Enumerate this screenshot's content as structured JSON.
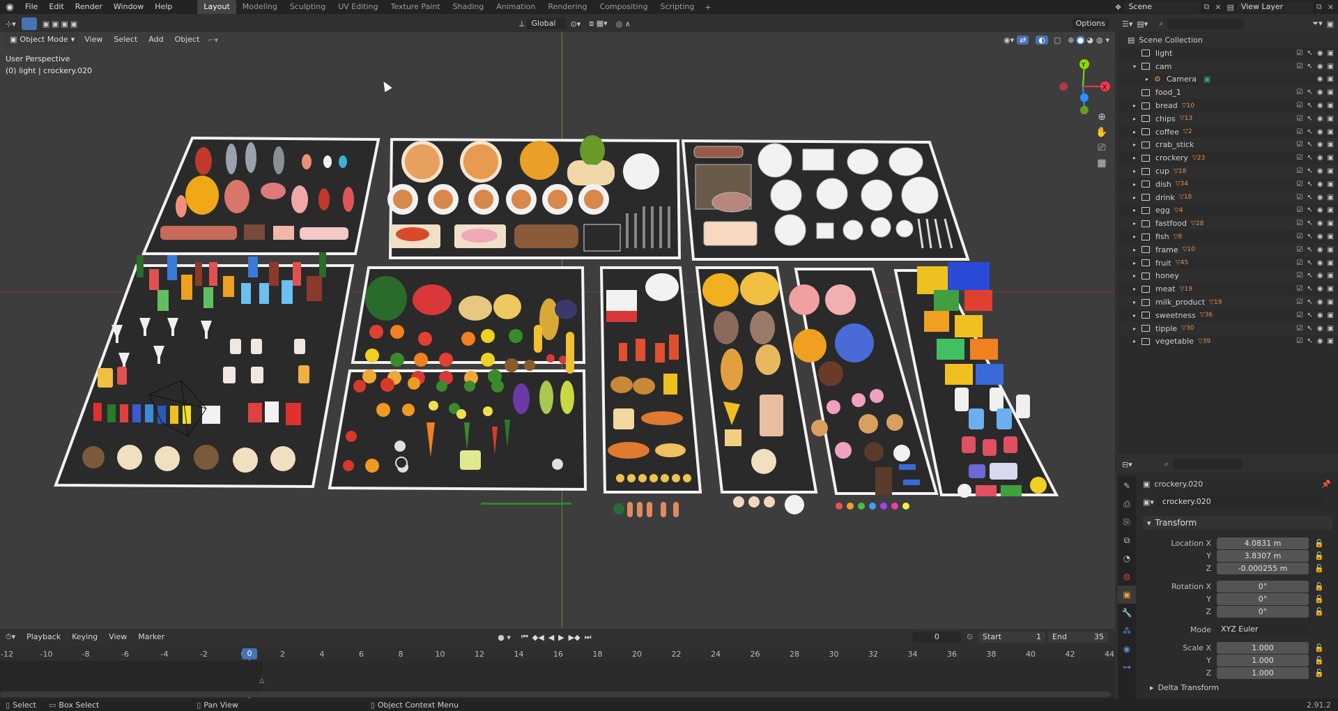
{
  "topbar": {
    "menus": [
      "File",
      "Edit",
      "Render",
      "Window",
      "Help"
    ],
    "workspaces": [
      "Layout",
      "Modeling",
      "Sculpting",
      "UV Editing",
      "Texture Paint",
      "Shading",
      "Animation",
      "Rendering",
      "Compositing",
      "Scripting"
    ],
    "active_workspace": "Layout",
    "scene_label": "Scene",
    "view_layer_label": "View Layer"
  },
  "viewport_header": {
    "transform_orientation": "Global",
    "options_label": "Options",
    "mode": "Object Mode",
    "menus": [
      "View",
      "Select",
      "Add",
      "Object"
    ]
  },
  "viewport": {
    "perspective_label": "User Perspective",
    "object_info": "(0) light | crockery.020",
    "gizmo_axes": [
      "X",
      "Y",
      "Z"
    ]
  },
  "outliner": {
    "root": "Scene Collection",
    "items": [
      {
        "label": "light",
        "level": 1,
        "expand": false,
        "badge": ""
      },
      {
        "label": "cam",
        "level": 1,
        "expand": true,
        "badge": ""
      },
      {
        "label": "Camera",
        "level": 2,
        "expand": false,
        "badge": "",
        "is_object": true
      },
      {
        "label": "food_1",
        "level": 1,
        "expand": false,
        "badge": ""
      },
      {
        "label": "bread",
        "level": 1,
        "expand": false,
        "badge": "10"
      },
      {
        "label": "chips",
        "level": 1,
        "expand": false,
        "badge": "13"
      },
      {
        "label": "coffee",
        "level": 1,
        "expand": false,
        "badge": "2"
      },
      {
        "label": "crab_stick",
        "level": 1,
        "expand": false,
        "badge": ""
      },
      {
        "label": "crockery",
        "level": 1,
        "expand": false,
        "badge": "23"
      },
      {
        "label": "cup",
        "level": 1,
        "expand": false,
        "badge": "18"
      },
      {
        "label": "dish",
        "level": 1,
        "expand": false,
        "badge": "34"
      },
      {
        "label": "drink",
        "level": 1,
        "expand": false,
        "badge": "18"
      },
      {
        "label": "egg",
        "level": 1,
        "expand": false,
        "badge": "4"
      },
      {
        "label": "fastfood",
        "level": 1,
        "expand": false,
        "badge": "28"
      },
      {
        "label": "fish",
        "level": 1,
        "expand": false,
        "badge": "8"
      },
      {
        "label": "frame",
        "level": 1,
        "expand": false,
        "badge": "10"
      },
      {
        "label": "fruit",
        "level": 1,
        "expand": false,
        "badge": "45"
      },
      {
        "label": "honey",
        "level": 1,
        "expand": false,
        "badge": ""
      },
      {
        "label": "meat",
        "level": 1,
        "expand": false,
        "badge": "19"
      },
      {
        "label": "milk_product",
        "level": 1,
        "expand": false,
        "badge": "19"
      },
      {
        "label": "sweetness",
        "level": 1,
        "expand": false,
        "badge": "36"
      },
      {
        "label": "tipple",
        "level": 1,
        "expand": false,
        "badge": "30"
      },
      {
        "label": "vegetable",
        "level": 1,
        "expand": false,
        "badge": "39"
      }
    ]
  },
  "properties": {
    "object_name": "crockery.020",
    "data_name": "crockery.020",
    "section": "Transform",
    "location": {
      "label": "Location X",
      "x": "4.0831 m",
      "y": "3.8307 m",
      "z": "-0.000255 m"
    },
    "rotation": {
      "label": "Rotation X",
      "x": "0°",
      "y": "0°",
      "z": "0°"
    },
    "mode_label": "Mode",
    "mode_value": "XYZ Euler",
    "scale": {
      "label": "Scale X",
      "x": "1.000",
      "y": "1.000",
      "z": "1.000"
    },
    "delta": "Delta Transform",
    "axis_y": "Y",
    "axis_z": "Z"
  },
  "timeline": {
    "menus": [
      "Playback",
      "Keying",
      "View",
      "Marker"
    ],
    "current_frame": "0",
    "start_label": "Start",
    "start": "1",
    "end_label": "End",
    "end": "35",
    "ticks": [
      "-12",
      "-10",
      "-8",
      "-6",
      "-4",
      "-2",
      "0",
      "2",
      "4",
      "6",
      "8",
      "10",
      "12",
      "14",
      "16",
      "18",
      "20",
      "22",
      "24",
      "26",
      "28",
      "30",
      "32",
      "34",
      "36",
      "38",
      "40",
      "42",
      "44"
    ]
  },
  "statusbar": {
    "select": "Select",
    "box_select": "Box Select",
    "pan_view": "Pan View",
    "context_menu": "Object Context Menu",
    "version": "2.91.2"
  },
  "colors": {
    "accent": "#4772b3",
    "active_tab": "#434343",
    "x_axis": "#ff3352",
    "y_axis": "#8bdc00",
    "z_axis": "#2890ff",
    "mesh_badge": "#e3914b"
  }
}
